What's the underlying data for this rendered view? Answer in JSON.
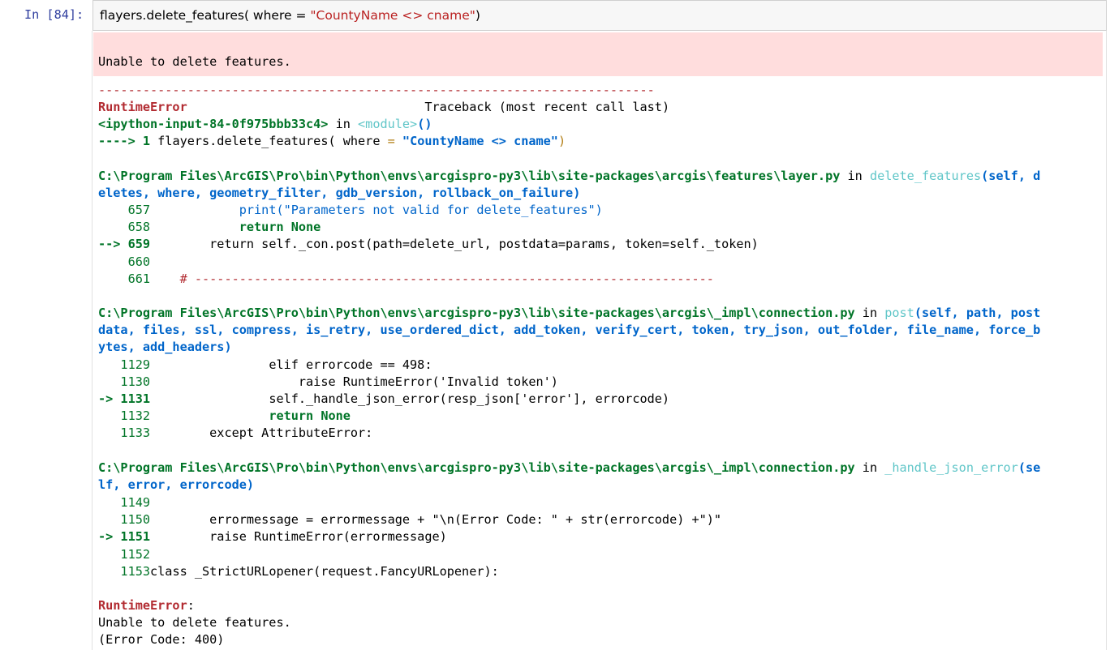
{
  "prompt": "In [84]:",
  "input": {
    "prefix": "flayers.delete_features( where = ",
    "string": "\"CountyName <> cname\"",
    "suffix": ")"
  },
  "stderr_message": "Unable to delete features.",
  "traceback": {
    "separator": "---------------------------------------------------------------------------",
    "error_name": "RuntimeError",
    "header_spacing": "                                ",
    "header_right": "Traceback (most recent call last)",
    "ipython_input": "<ipython-input-84-0f975bbb33c4>",
    "in_word": " in ",
    "module_word": "<module>",
    "module_parens": "()",
    "arrow_line": {
      "arrow": "----> 1 ",
      "code_a": "flayers.delete_features( where ",
      "eq": "=",
      "code_b": " ",
      "string": "\"CountyName <> cname\"",
      "paren": ")"
    },
    "frame1": {
      "path": "C:\\Program Files\\ArcGIS\\Pro\\bin\\Python\\envs\\arcgispro-py3\\lib\\site-packages\\arcgis\\features\\layer.py",
      "func": "delete_features",
      "sig_1": "(self, d",
      "sig_2": "eletes, where, geometry_filter, gdb_version, rollback_on_failure)",
      "lines": [
        {
          "no": "    657",
          "code": "            print(\"Parameters not valid for delete_features\")"
        },
        {
          "no": "    658",
          "code": "            return None"
        },
        {
          "no": "--> 659",
          "code": "        return self._con.post(path=delete_url, postdata=params, token=self._token)"
        },
        {
          "no": "    660",
          "code": ""
        },
        {
          "no": "    661",
          "code": "    # ----------------------------------------------------------------------"
        }
      ]
    },
    "frame2": {
      "path": "C:\\Program Files\\ArcGIS\\Pro\\bin\\Python\\envs\\arcgispro-py3\\lib\\site-packages\\arcgis\\_impl\\connection.py",
      "func": "post",
      "sig_1": "(self, path, post",
      "sig_2": "data, files, ssl, compress, is_retry, use_ordered_dict, add_token, verify_cert, token, try_json, out_folder, file_name, force_b",
      "sig_3": "ytes, add_headers)",
      "lines": [
        {
          "no": "   1129",
          "code": "                elif errorcode == 498:"
        },
        {
          "no": "   1130",
          "code": "                    raise RuntimeError('Invalid token')"
        },
        {
          "no": "-> 1131",
          "code": "                self._handle_json_error(resp_json['error'], errorcode)"
        },
        {
          "no": "   1132",
          "code": "                return None"
        },
        {
          "no": "   1133",
          "code": "        except AttributeError:"
        }
      ]
    },
    "frame3": {
      "path": "C:\\Program Files\\ArcGIS\\Pro\\bin\\Python\\envs\\arcgispro-py3\\lib\\site-packages\\arcgis\\_impl\\connection.py",
      "func": "_handle_json_error",
      "sig_1": "(se",
      "sig_2": "lf, error, errorcode)",
      "lines": [
        {
          "no": "   1149",
          "code": ""
        },
        {
          "no": "   1150",
          "code": "        errormessage = errormessage + \"\\n(Error Code: \" + str(errorcode) +\")\""
        },
        {
          "no": "-> 1151",
          "code": "        raise RuntimeError(errormessage)"
        },
        {
          "no": "   1152",
          "code": ""
        },
        {
          "no": "   1153",
          "code": "class _StrictURLopener(request.FancyURLopener):"
        }
      ]
    },
    "final_error": "RuntimeError",
    "final_colon": ":",
    "final_msg_1": "Unable to delete features.",
    "final_msg_2": "(Error Code: 400)"
  }
}
